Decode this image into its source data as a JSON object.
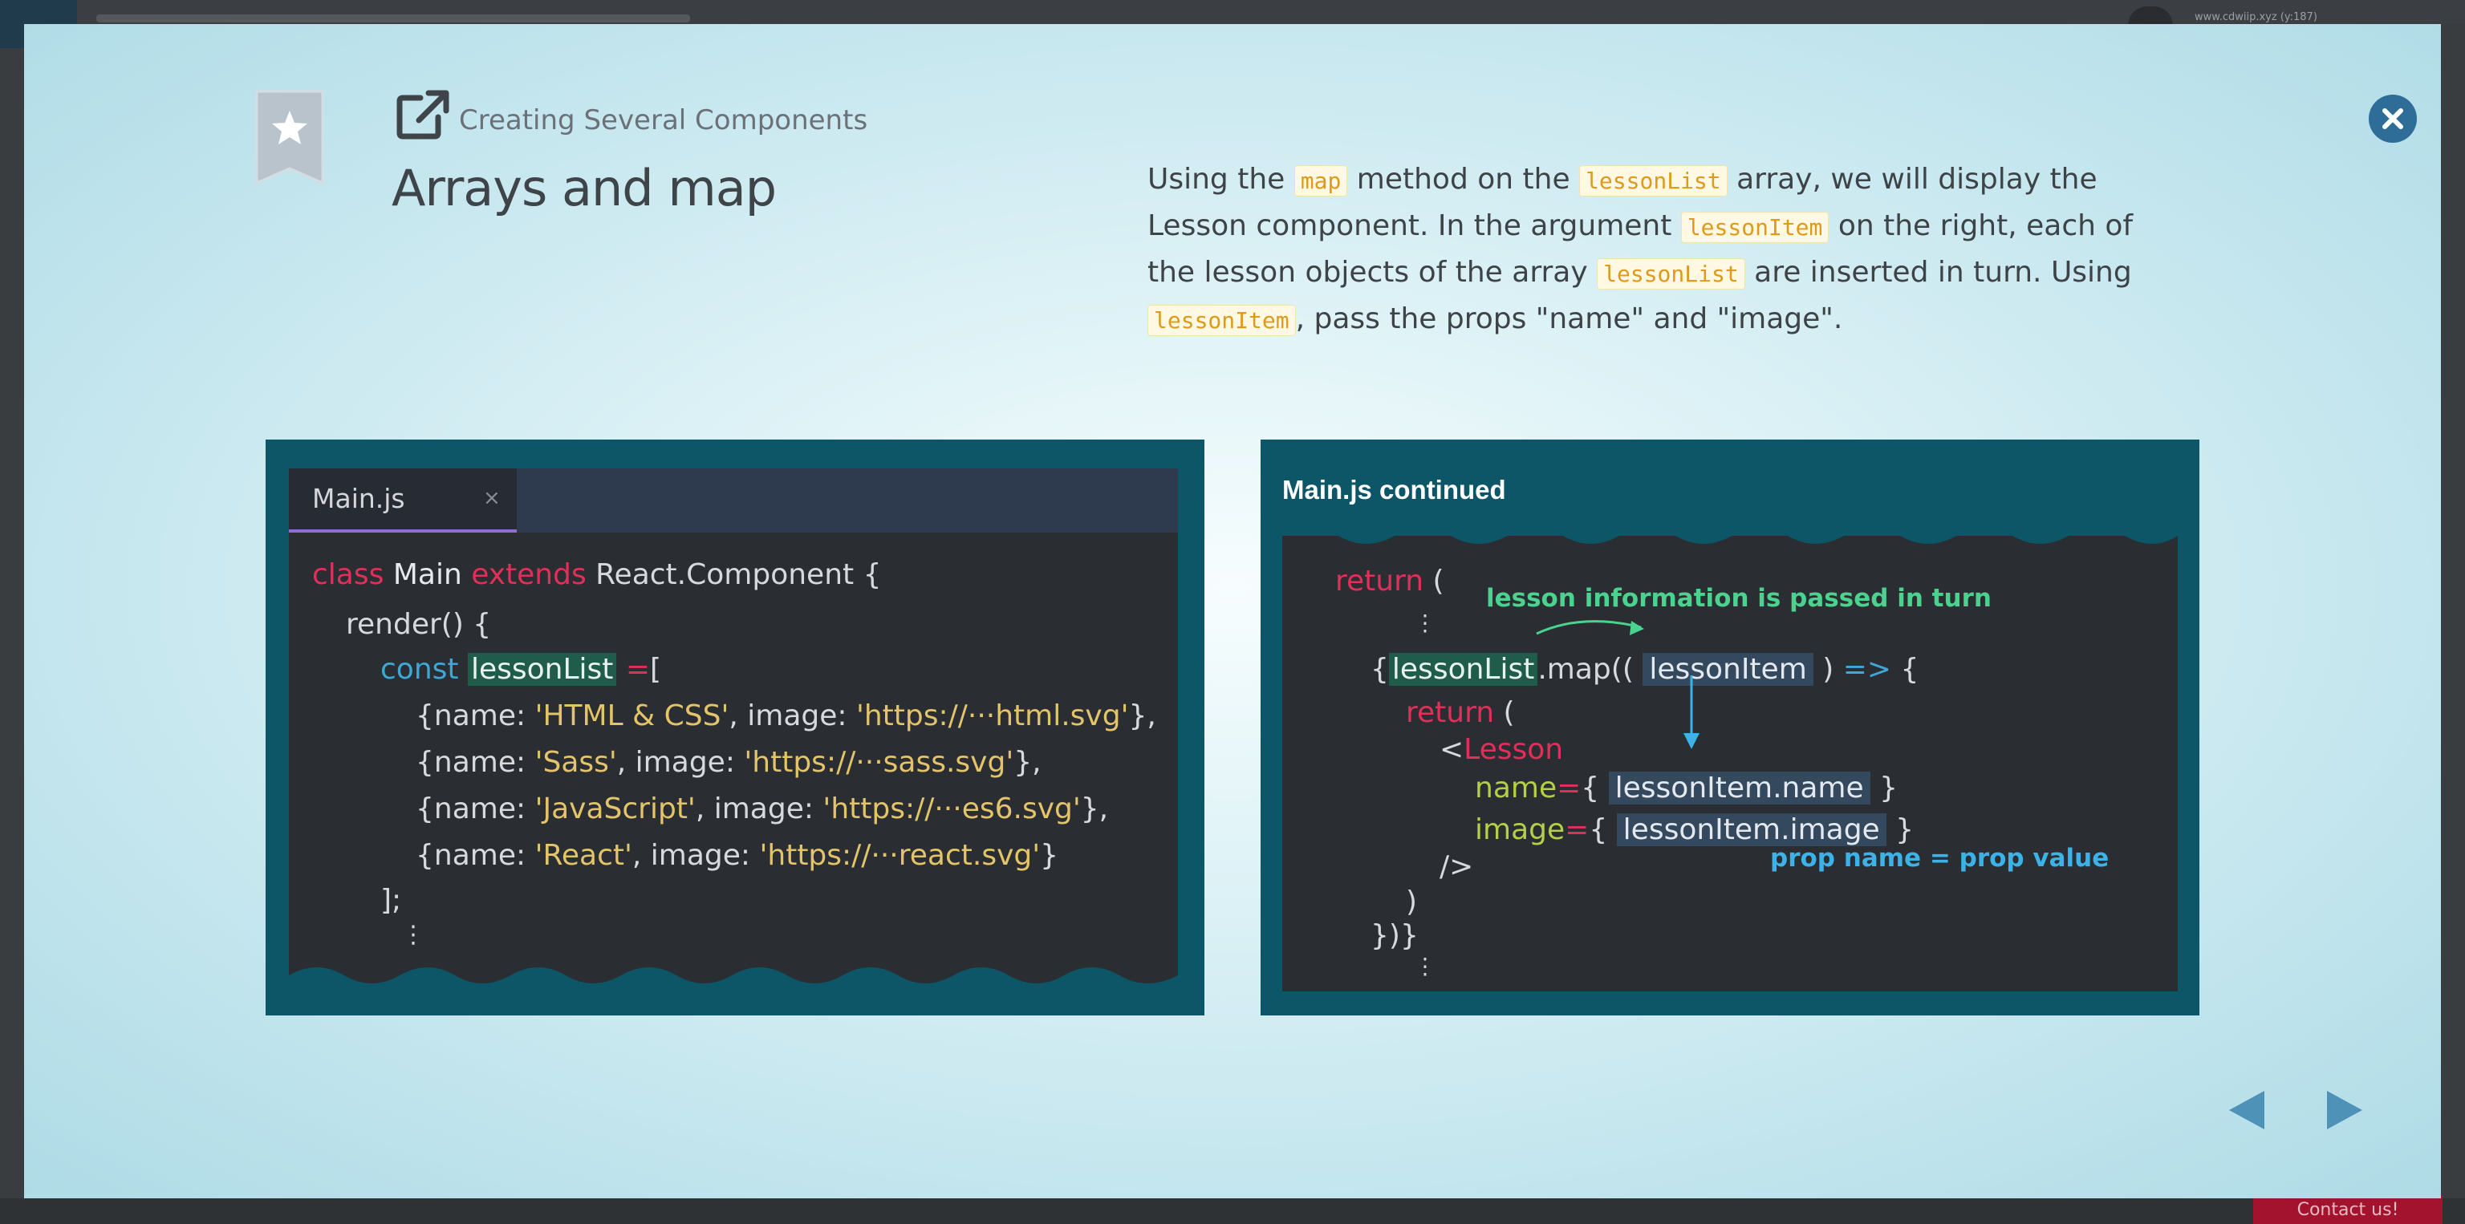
{
  "backdrop": {
    "url_text": "www.cdwiip.xyz (y:187)",
    "contact_label": "Contact us!"
  },
  "slide": {
    "breadcrumb": "Creating Several Components",
    "title": "Arrays and map",
    "description": {
      "p1": "Using the ",
      "c1": "map",
      "p2": " method on the ",
      "c2": "lessonList",
      "p3": " array, we will display the Lesson component. In the argument ",
      "c3": "lessonItem",
      "p4": " on the right, each of the lesson objects of the array ",
      "c4": "lessonList",
      "p5": " are inserted in turn. Using ",
      "c5": "lessonItem",
      "p6": ", pass the props \"name\" and \"image\"."
    }
  },
  "left_panel": {
    "tab_label": "Main.js",
    "tab_close": "×",
    "code": {
      "l1_kw1": "class",
      "l1_name": " Main ",
      "l1_kw2": "extends",
      "l1_rest": " React.Component {",
      "l2": "render() {",
      "l3_kw": "const",
      "l3_var": "lessonList",
      "l3_op": " =",
      "l3_rest": "[",
      "items": [
        {
          "pre": "{name: ",
          "name": "'HTML & CSS'",
          "mid": ", image: ",
          "img": "'https://···html.svg'",
          "post": "},"
        },
        {
          "pre": "{name: ",
          "name": "'Sass'",
          "mid": ", image: ",
          "img": "'https://···sass.svg'",
          "post": "},"
        },
        {
          "pre": "{name: ",
          "name": "'JavaScript'",
          "mid": ", image: ",
          "img": "'https://···es6.svg'",
          "post": "},"
        },
        {
          "pre": "{name: ",
          "name": "'React'",
          "mid": ", image: ",
          "img": "'https://···react.svg'",
          "post": "}"
        }
      ],
      "close": "];",
      "ellipsis": "⋮"
    }
  },
  "right_panel": {
    "title": "Main.js continued",
    "code": {
      "return1": "return",
      "paren": " (",
      "ellipsis": "⋮",
      "brace_open": "{",
      "list_var": "lessonList",
      "map_call": ".map((",
      "item_var": "lessonItem",
      "arrow_pre": " ) ",
      "arrow": "=>",
      "arrow_post": " {",
      "return2": "return",
      "lt": "<",
      "component": "Lesson",
      "attr_name": "name",
      "eq": "=",
      "brace": "{",
      "name_val": "lessonItem.name",
      "brace_close": " }",
      "attr_image": "image",
      "image_val": "lessonItem.image",
      "self_close": "/>",
      "close_paren": ")",
      "close_all": "})}"
    },
    "annotation_pass": "lesson information is passed in turn",
    "annotation_prop": "prop name = prop value"
  },
  "colors": {
    "panel_bg": "#0d5667",
    "close_button": "#2e6d98",
    "nav_arrow": "#4f92b8",
    "keyword_red": "#e0305a",
    "string_yellow": "#e3c46a"
  }
}
